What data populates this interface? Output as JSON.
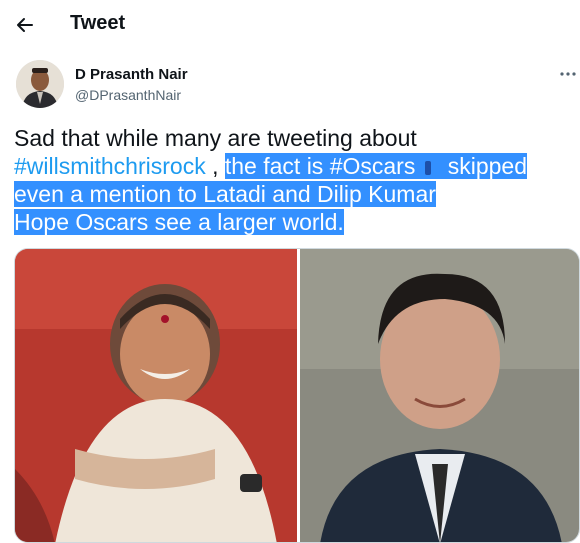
{
  "header": {
    "title": "Tweet",
    "back_icon": "arrow-left-icon"
  },
  "author": {
    "name": "D Prasanth Nair",
    "handle": "@DPrasanthNair"
  },
  "tweet": {
    "line1": "Sad that while many are tweeting about",
    "hashtag1": "#willsmithchrisrock",
    "line2_mid": " , ",
    "line2_hl_a": "the fact is ",
    "hashtag2": "#Oscars",
    "line2_hl_b": " skipped",
    "line3": "even a mention to Latadi and Dilip Kumar",
    "line4": "Hope Oscars see a larger world."
  },
  "colors": {
    "link": "#1d9bf0",
    "selection": "#3390ff",
    "secondary_text": "#536471",
    "border": "#cfd9de"
  },
  "media": {
    "image_count": 2
  }
}
